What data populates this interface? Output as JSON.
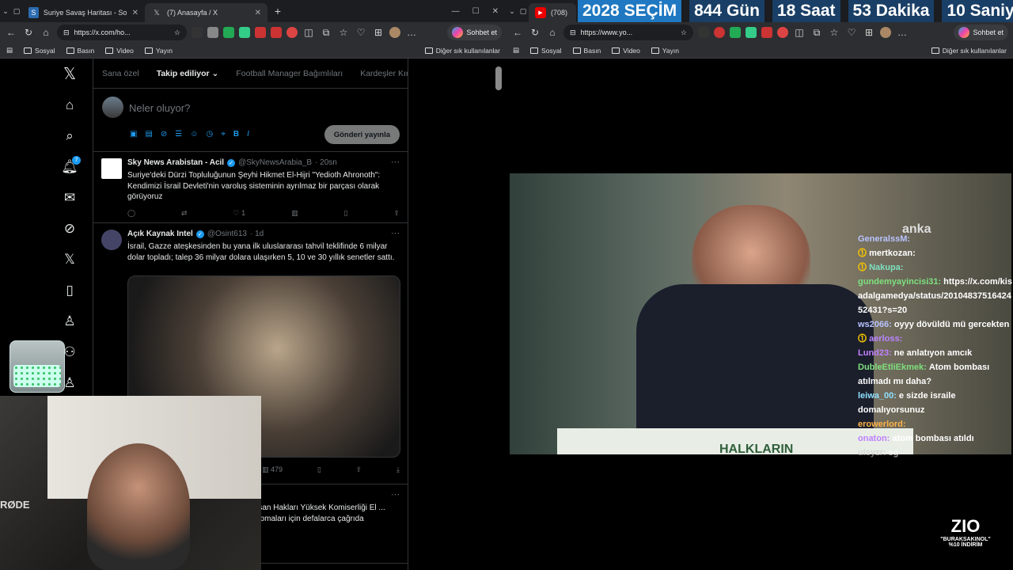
{
  "left": {
    "tabs": [
      {
        "title": "Suriye Savaş Haritası - Son Dakika"
      },
      {
        "title": "(7) Anasayfa / X"
      }
    ],
    "url": "https://x.com/ho...",
    "copilot": "Sohbet et",
    "bookmarks": [
      "Sosyal",
      "Basın",
      "Video",
      "Yayın"
    ],
    "other_bookmarks": "Diğer sık kullanılanlar",
    "nav_badge": "7",
    "feed_tabs": [
      "Sana özel",
      "Takip ediliyor",
      "Football Manager Bağımlıları",
      "Kardeşler Kıraat"
    ],
    "compose_placeholder": "Neler oluyor?",
    "post_button": "Gönderi yayınla",
    "tweets": [
      {
        "name": "Sky News Arabistan - Acil",
        "handle": "@SkyNewsArabia_B",
        "time": "· 20sn",
        "text": "Suriye'deki Dürzi Topluluğunun Şeyhi Hikmet El-Hijri \"Yedioth Ahronoth\": Kendimizi İsrail Devleti'nin varoluş sisteminin ayrılmaz bir parçası olarak görüyoruz",
        "likes": "1"
      },
      {
        "name": "Açık Kaynak Intel",
        "handle": "@Osint613",
        "time": "· 1d",
        "text": "İsrail, Gazze ateşkesinden bu yana ilk uluslararası tahvil teklifinde 6 milyar dolar topladı; talep 36 milyar dolara ulaşırken 5, 10 ve 30 yıllık senetler sattı.",
        "views": "479"
      },
      {
        "text": "...san Hakları Yüksek Komiserliği El ... yapmaları için defalarca çağrıda"
      }
    ]
  },
  "right": {
    "tab_count": "(708)",
    "url": "https://www.yo...",
    "copilot": "Sohbet et",
    "bookmarks": [
      "Sosyal",
      "Basın",
      "Video",
      "Yayın"
    ],
    "other_bookmarks": "Diğer sık kullanılanlar",
    "countdown": {
      "year": "2028",
      "label": "SEÇİM",
      "days": "844",
      "days_label": "Gün",
      "hours": "18",
      "hours_label": "Saat",
      "minutes": "53",
      "minutes_label": "Dakika",
      "seconds": "10",
      "seconds_label": "Saniye"
    },
    "video_watermark": "anka",
    "podium_text": "HALKLARIN",
    "chat": [
      {
        "user": "GeneralssM:",
        "msg": "",
        "color": "#b8c3ff"
      },
      {
        "user": "mertkozan:",
        "msg": "",
        "color": "#ffffff"
      },
      {
        "user": "Nakupa:",
        "msg": "",
        "color": "#7ee0c0"
      },
      {
        "user": "gundemyayincisi31:",
        "msg": "https://x.com/kisadalgamedya/status/2010483751642452431?s=20",
        "color": "#7ee07e"
      },
      {
        "user": "ws2066:",
        "msg": "oyyy dövüldü mü gercekten",
        "color": "#b8c3ff"
      },
      {
        "user": "aerloss:",
        "msg": "",
        "color": "#b985ff"
      },
      {
        "user": "Lund23:",
        "msg": "ne anlatıyon amcık",
        "color": "#c080ff"
      },
      {
        "user": "DubleEtliEkmek:",
        "msg": "Atom bombası atılmadı mı daha?",
        "color": "#7ee07e"
      },
      {
        "user": "leiwa_00:",
        "msg": "e sizde israile domalıyorsunuz",
        "color": "#8fe0ff"
      },
      {
        "user": "erowerlord:",
        "msg": "",
        "color": "#ffb347"
      },
      {
        "user": "onaton:",
        "msg": "atom bombası atıldı",
        "color": "#c080ff"
      },
      {
        "user": "ulsyzr:",
        "msg": "sg",
        "color": "#cccccc"
      }
    ],
    "promo": {
      "brand": "ZIO",
      "code": "\"BURAKSAKINOL\"",
      "discount": "%10 İNDİRİM"
    }
  },
  "webcam_brand": "RØDE"
}
